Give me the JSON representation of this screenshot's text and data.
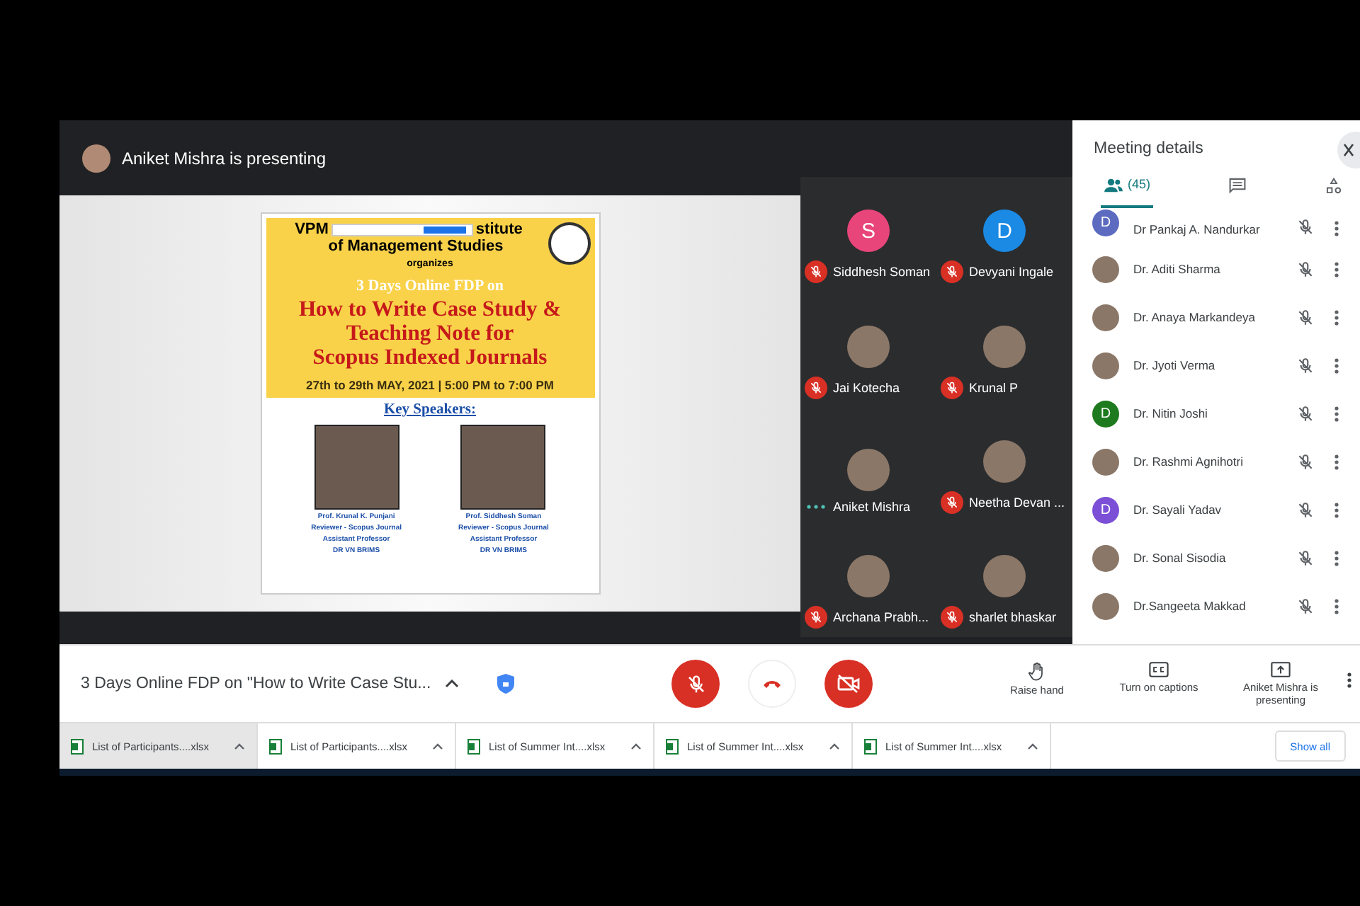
{
  "presenter_banner": {
    "text": "Aniket Mishra is presenting"
  },
  "slide": {
    "org_line_start": "VPM",
    "org_line_end": "stitute",
    "org_line_2": "of Management Studies",
    "organizes": "organizes",
    "event_type": "3 Days Online FDP on",
    "title_lines": [
      "How to Write Case Study &",
      "Teaching Note for",
      "Scopus  Indexed  Journals"
    ],
    "dates": "27th to 29th MAY, 2021 | 5:00 PM to 7:00 PM",
    "speakers_heading": "Key Speakers:",
    "speakers": [
      {
        "caption": [
          "Prof. Krunal K. Punjani",
          "Reviewer - Scopus Journal",
          "Assistant Professor",
          "DR VN BRIMS"
        ]
      },
      {
        "caption": [
          "Prof. Siddhesh Soman",
          "Reviewer - Scopus Journal",
          "Assistant Professor",
          "DR VN BRIMS"
        ]
      }
    ]
  },
  "tiles": [
    {
      "name": "Siddhesh Soman",
      "kind": "letter",
      "letter": "S",
      "color": "#e8457a",
      "muted": true
    },
    {
      "name": "Devyani Ingale",
      "kind": "letter",
      "letter": "D",
      "color": "#1a8ae5",
      "muted": true
    },
    {
      "name": "Jai Kotecha",
      "kind": "photo",
      "muted": true
    },
    {
      "name": "Krunal P",
      "kind": "photo",
      "muted": true
    },
    {
      "name": "Aniket Mishra",
      "kind": "photo",
      "muted": false
    },
    {
      "name": "Neetha Devan ...",
      "kind": "photo",
      "muted": true
    },
    {
      "name": "Archana Prabh...",
      "kind": "photo",
      "muted": true
    },
    {
      "name": "sharlet bhaskar",
      "kind": "photo",
      "muted": true
    }
  ],
  "sidebar": {
    "title": "Meeting details",
    "tabs": [
      {
        "kind": "people",
        "label": "(45)",
        "selected": true
      },
      {
        "kind": "chat",
        "selected": false
      },
      {
        "kind": "activities",
        "selected": false
      }
    ],
    "participants": [
      {
        "name": "Dr Pankaj A. Nandurkar",
        "kind": "letter",
        "letter": "D",
        "color": "#5c6bc0"
      },
      {
        "name": "Dr. Aditi Sharma",
        "kind": "photo"
      },
      {
        "name": "Dr. Anaya Markandeya",
        "kind": "photo"
      },
      {
        "name": "Dr. Jyoti Verma",
        "kind": "photo"
      },
      {
        "name": "Dr. Nitin Joshi",
        "kind": "letter",
        "letter": "D",
        "color": "#1e7a1e"
      },
      {
        "name": "Dr. Rashmi Agnihotri",
        "kind": "photo"
      },
      {
        "name": "Dr. Sayali Yadav",
        "kind": "letter",
        "letter": "D",
        "color": "#7b4fd6"
      },
      {
        "name": "Dr. Sonal Sisodia",
        "kind": "photo"
      },
      {
        "name": "Dr.Sangeeta Makkad",
        "kind": "photo"
      }
    ]
  },
  "controls": {
    "meeting_title": "3 Days Online FDP on \"How to Write Case Stu...",
    "actions": [
      {
        "label": "Raise hand",
        "kind": "hand"
      },
      {
        "label": "Turn on captions",
        "kind": "captions"
      },
      {
        "label": "Aniket Mishra is presenting",
        "kind": "present"
      }
    ]
  },
  "downloads": {
    "items": [
      {
        "name": "List of Participants....xlsx",
        "selected": true
      },
      {
        "name": "List of Participants....xlsx",
        "selected": false
      },
      {
        "name": "List of Summer Int....xlsx",
        "selected": false
      },
      {
        "name": "List of Summer Int....xlsx",
        "selected": false
      },
      {
        "name": "List of Summer Int....xlsx",
        "selected": false
      }
    ],
    "show_all": "Show all"
  }
}
